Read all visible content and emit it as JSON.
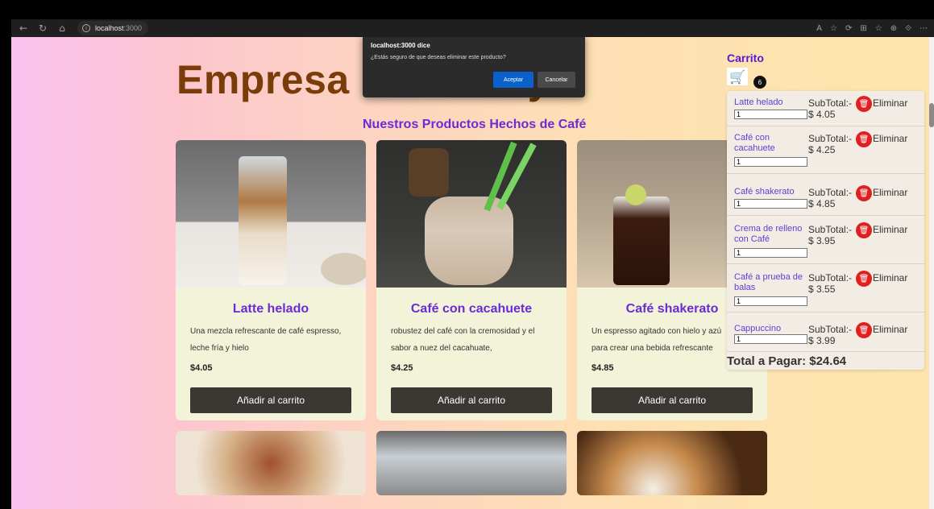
{
  "browser": {
    "url_host": "localhost",
    "url_port": ":3000",
    "nav_back": "←",
    "nav_reload": "↻",
    "nav_home": "⌂",
    "right_icons": [
      "A",
      "☆",
      "⟳",
      "⊞",
      "☆",
      "⊕",
      "⟐",
      "⋯"
    ]
  },
  "page": {
    "brand_title": "Empresa C",
    "brand_title_tail": "ya",
    "products_heading": "Nuestros Productos Hechos de Café"
  },
  "products": [
    {
      "name": "Latte helado",
      "desc1": "Una mezcla refrescante de café espresso,",
      "desc2": "leche fría y hielo",
      "price": "$4.05",
      "button": "Añadir al carrito"
    },
    {
      "name": "Café con cacahuete",
      "desc1": "robustez del café con la cremosidad y el",
      "desc2": "sabor a nuez del cacahuate,",
      "price": "$4.25",
      "button": "Añadir al carrito"
    },
    {
      "name": "Café shakerato",
      "desc1": "Un espresso agitado con hielo y azú",
      "desc2": "para crear una bebida refrescante",
      "price": "$4.85",
      "button": "Añadir al carrito"
    }
  ],
  "cart": {
    "title": "Carrito",
    "count": "6",
    "cart_icon": "🛒",
    "items": [
      {
        "name": "Latte helado",
        "subtotal_label": "SubTotal:-",
        "subtotal": "$ 4.05",
        "qty": "1",
        "delete_label": "Eliminar"
      },
      {
        "name": "Café con cacahuete",
        "subtotal_label": "SubTotal:-",
        "subtotal": "$ 4.25",
        "qty": "1",
        "delete_label": "Eliminar"
      },
      {
        "name": "Café shakerato",
        "subtotal_label": "SubTotal:-",
        "subtotal": "$ 4.85",
        "qty": "1",
        "delete_label": "Eliminar"
      },
      {
        "name": "Crema de relleno con Café",
        "subtotal_label": "SubTotal:-",
        "subtotal": "$ 3.95",
        "qty": "1",
        "delete_label": "Eliminar"
      },
      {
        "name": "Café a prueba de balas",
        "subtotal_label": "SubTotal:-",
        "subtotal": "$ 3.55",
        "qty": "1",
        "delete_label": "Eliminar"
      },
      {
        "name": "Cappuccino",
        "subtotal_label": "SubTotal:-",
        "subtotal": "$ 3.99",
        "qty": "1",
        "delete_label": "Eliminar"
      }
    ],
    "total": "Total a Pagar: $24.64"
  },
  "dialog": {
    "title": "localhost:3000 dice",
    "message": "¿Estás seguro de que deseas eliminar este producto?",
    "accept": "Aceptar",
    "cancel": "Cancelar"
  },
  "colors": {
    "brand": "#7a3c08",
    "accent": "#6a2cd6",
    "button_dark": "#3b3834",
    "delete_red": "#e02020",
    "dialog_accept": "#0a61c9"
  }
}
